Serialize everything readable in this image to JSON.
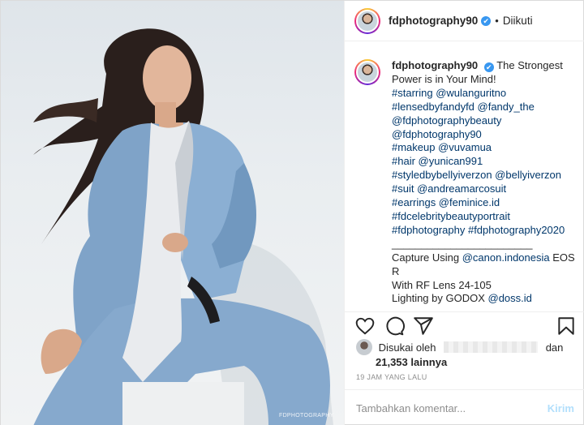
{
  "post": {
    "username": "fdphotography90",
    "verified_mark": "✔",
    "separator": "•",
    "follow_status": "Diikuti"
  },
  "caption": {
    "username": "fdphotography90",
    "lines": [
      {
        "a": "The Strongest",
        "a_type": "plain"
      },
      {
        "a": "Power is in Your Mind!",
        "a_type": "plain"
      },
      {
        "a": "#starring @wulanguritno",
        "a_type": "tag"
      },
      {
        "a": "#lensedbyfandyfd @fandy_the",
        "a_type": "tag"
      },
      {
        "a": "@fdphotographybeauty",
        "a_type": "tag"
      },
      {
        "a": "@fdphotography90",
        "a_type": "tag"
      },
      {
        "a": "#makeup @vuvamua",
        "a_type": "tag"
      },
      {
        "a": "#hair @yunican991",
        "a_type": "tag"
      },
      {
        "a": "#styledbybellyiverzon @bellyiverzon",
        "a_type": "tag"
      },
      {
        "a": "#suit @andreamarcosuit",
        "a_type": "tag"
      },
      {
        "a": "#earrings @feminice.id",
        "a_type": "tag"
      },
      {
        "a": "#fdcelebritybeautyportrait",
        "a_type": "tag"
      },
      {
        "a": "#fdphotography #fdphotography2020",
        "a_type": "tag"
      },
      {
        "a": "________________________",
        "a_type": "plain"
      },
      {
        "a": "Capture Using ",
        "a_type": "plain",
        "b": "@canon.indonesia",
        "c": " EOS"
      },
      {
        "a": "R",
        "a_type": "plain"
      },
      {
        "a": "With RF Lens 24-105",
        "a_type": "plain"
      },
      {
        "a": "Lighting by GODOX ",
        "a_type": "plain",
        "b": "@doss.id"
      }
    ]
  },
  "actions": {
    "like_icon": "heart-icon",
    "comment_icon": "comment-icon",
    "share_icon": "paper-plane-icon",
    "save_icon": "bookmark-icon"
  },
  "likes": {
    "prefix": "Disukai oleh",
    "suffix": "dan",
    "count": "21,353 lainnya"
  },
  "timestamp": "19 JAM YANG LALU",
  "comment": {
    "placeholder": "Tambahkan komentar...",
    "post_label": "Kirim"
  },
  "watermark": "FDPHOTOGRAPHY"
}
